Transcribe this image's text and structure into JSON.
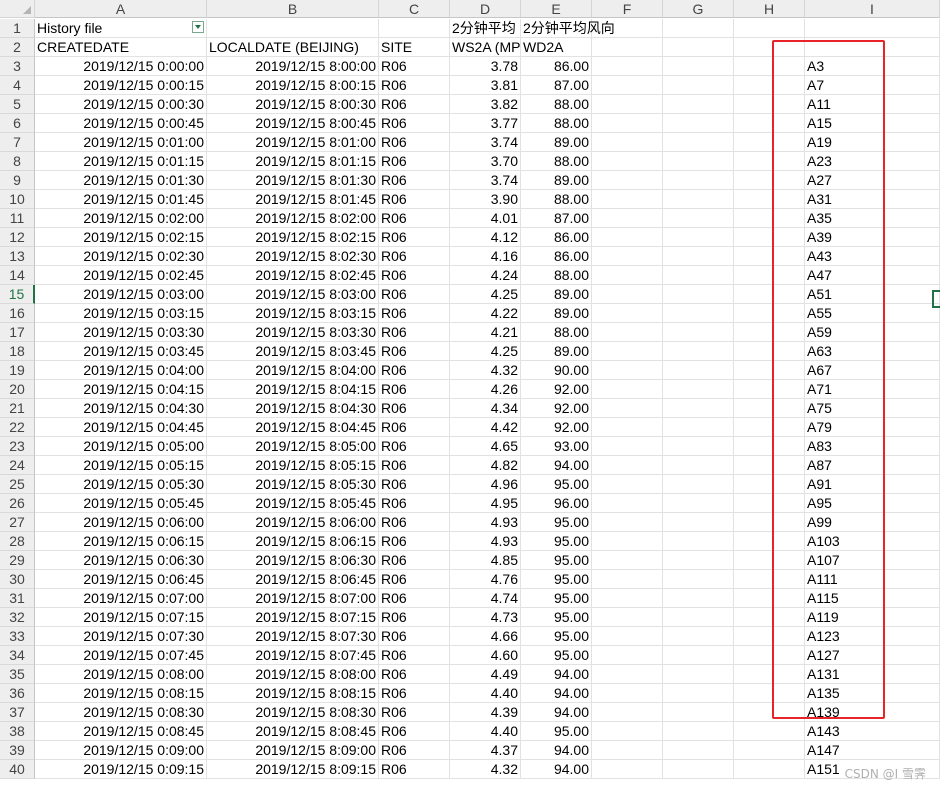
{
  "columns": [
    "A",
    "B",
    "C",
    "D",
    "E",
    "F",
    "G",
    "H",
    "I"
  ],
  "header_rows": [
    {
      "row": "1",
      "cells": {
        "A": "History file",
        "D": "2分钟平均",
        "E": "2分钟平均风向"
      }
    },
    {
      "row": "2",
      "cells": {
        "A": "CREATEDATE",
        "B": "LOCALDATE (BEIJING)",
        "C": "SITE",
        "D": "WS2A (MP",
        "E": "WD2A"
      }
    }
  ],
  "data_rows": [
    {
      "row": "3",
      "A": "2019/12/15 0:00:00",
      "B": "2019/12/15 8:00:00",
      "C": "R06",
      "D": "3.78",
      "E": "86.00",
      "I": "A3"
    },
    {
      "row": "4",
      "A": "2019/12/15 0:00:15",
      "B": "2019/12/15 8:00:15",
      "C": "R06",
      "D": "3.81",
      "E": "87.00",
      "I": "A7"
    },
    {
      "row": "5",
      "A": "2019/12/15 0:00:30",
      "B": "2019/12/15 8:00:30",
      "C": "R06",
      "D": "3.82",
      "E": "88.00",
      "I": "A11"
    },
    {
      "row": "6",
      "A": "2019/12/15 0:00:45",
      "B": "2019/12/15 8:00:45",
      "C": "R06",
      "D": "3.77",
      "E": "88.00",
      "I": "A15"
    },
    {
      "row": "7",
      "A": "2019/12/15 0:01:00",
      "B": "2019/12/15 8:01:00",
      "C": "R06",
      "D": "3.74",
      "E": "89.00",
      "I": "A19"
    },
    {
      "row": "8",
      "A": "2019/12/15 0:01:15",
      "B": "2019/12/15 8:01:15",
      "C": "R06",
      "D": "3.70",
      "E": "88.00",
      "I": "A23"
    },
    {
      "row": "9",
      "A": "2019/12/15 0:01:30",
      "B": "2019/12/15 8:01:30",
      "C": "R06",
      "D": "3.74",
      "E": "89.00",
      "I": "A27"
    },
    {
      "row": "10",
      "A": "2019/12/15 0:01:45",
      "B": "2019/12/15 8:01:45",
      "C": "R06",
      "D": "3.90",
      "E": "88.00",
      "I": "A31"
    },
    {
      "row": "11",
      "A": "2019/12/15 0:02:00",
      "B": "2019/12/15 8:02:00",
      "C": "R06",
      "D": "4.01",
      "E": "87.00",
      "I": "A35"
    },
    {
      "row": "12",
      "A": "2019/12/15 0:02:15",
      "B": "2019/12/15 8:02:15",
      "C": "R06",
      "D": "4.12",
      "E": "86.00",
      "I": "A39"
    },
    {
      "row": "13",
      "A": "2019/12/15 0:02:30",
      "B": "2019/12/15 8:02:30",
      "C": "R06",
      "D": "4.16",
      "E": "86.00",
      "I": "A43"
    },
    {
      "row": "14",
      "A": "2019/12/15 0:02:45",
      "B": "2019/12/15 8:02:45",
      "C": "R06",
      "D": "4.24",
      "E": "88.00",
      "I": "A47"
    },
    {
      "row": "15",
      "A": "2019/12/15 0:03:00",
      "B": "2019/12/15 8:03:00",
      "C": "R06",
      "D": "4.25",
      "E": "89.00",
      "I": "A51"
    },
    {
      "row": "16",
      "A": "2019/12/15 0:03:15",
      "B": "2019/12/15 8:03:15",
      "C": "R06",
      "D": "4.22",
      "E": "89.00",
      "I": "A55"
    },
    {
      "row": "17",
      "A": "2019/12/15 0:03:30",
      "B": "2019/12/15 8:03:30",
      "C": "R06",
      "D": "4.21",
      "E": "88.00",
      "I": "A59"
    },
    {
      "row": "18",
      "A": "2019/12/15 0:03:45",
      "B": "2019/12/15 8:03:45",
      "C": "R06",
      "D": "4.25",
      "E": "89.00",
      "I": "A63"
    },
    {
      "row": "19",
      "A": "2019/12/15 0:04:00",
      "B": "2019/12/15 8:04:00",
      "C": "R06",
      "D": "4.32",
      "E": "90.00",
      "I": "A67"
    },
    {
      "row": "20",
      "A": "2019/12/15 0:04:15",
      "B": "2019/12/15 8:04:15",
      "C": "R06",
      "D": "4.26",
      "E": "92.00",
      "I": "A71"
    },
    {
      "row": "21",
      "A": "2019/12/15 0:04:30",
      "B": "2019/12/15 8:04:30",
      "C": "R06",
      "D": "4.34",
      "E": "92.00",
      "I": "A75"
    },
    {
      "row": "22",
      "A": "2019/12/15 0:04:45",
      "B": "2019/12/15 8:04:45",
      "C": "R06",
      "D": "4.42",
      "E": "92.00",
      "I": "A79"
    },
    {
      "row": "23",
      "A": "2019/12/15 0:05:00",
      "B": "2019/12/15 8:05:00",
      "C": "R06",
      "D": "4.65",
      "E": "93.00",
      "I": "A83"
    },
    {
      "row": "24",
      "A": "2019/12/15 0:05:15",
      "B": "2019/12/15 8:05:15",
      "C": "R06",
      "D": "4.82",
      "E": "94.00",
      "I": "A87"
    },
    {
      "row": "25",
      "A": "2019/12/15 0:05:30",
      "B": "2019/12/15 8:05:30",
      "C": "R06",
      "D": "4.96",
      "E": "95.00",
      "I": "A91"
    },
    {
      "row": "26",
      "A": "2019/12/15 0:05:45",
      "B": "2019/12/15 8:05:45",
      "C": "R06",
      "D": "4.95",
      "E": "96.00",
      "I": "A95"
    },
    {
      "row": "27",
      "A": "2019/12/15 0:06:00",
      "B": "2019/12/15 8:06:00",
      "C": "R06",
      "D": "4.93",
      "E": "95.00",
      "I": "A99"
    },
    {
      "row": "28",
      "A": "2019/12/15 0:06:15",
      "B": "2019/12/15 8:06:15",
      "C": "R06",
      "D": "4.93",
      "E": "95.00",
      "I": "A103"
    },
    {
      "row": "29",
      "A": "2019/12/15 0:06:30",
      "B": "2019/12/15 8:06:30",
      "C": "R06",
      "D": "4.85",
      "E": "95.00",
      "I": "A107"
    },
    {
      "row": "30",
      "A": "2019/12/15 0:06:45",
      "B": "2019/12/15 8:06:45",
      "C": "R06",
      "D": "4.76",
      "E": "95.00",
      "I": "A111"
    },
    {
      "row": "31",
      "A": "2019/12/15 0:07:00",
      "B": "2019/12/15 8:07:00",
      "C": "R06",
      "D": "4.74",
      "E": "95.00",
      "I": "A115"
    },
    {
      "row": "32",
      "A": "2019/12/15 0:07:15",
      "B": "2019/12/15 8:07:15",
      "C": "R06",
      "D": "4.73",
      "E": "95.00",
      "I": "A119"
    },
    {
      "row": "33",
      "A": "2019/12/15 0:07:30",
      "B": "2019/12/15 8:07:30",
      "C": "R06",
      "D": "4.66",
      "E": "95.00",
      "I": "A123"
    },
    {
      "row": "34",
      "A": "2019/12/15 0:07:45",
      "B": "2019/12/15 8:07:45",
      "C": "R06",
      "D": "4.60",
      "E": "95.00",
      "I": "A127"
    },
    {
      "row": "35",
      "A": "2019/12/15 0:08:00",
      "B": "2019/12/15 8:08:00",
      "C": "R06",
      "D": "4.49",
      "E": "94.00",
      "I": "A131"
    },
    {
      "row": "36",
      "A": "2019/12/15 0:08:15",
      "B": "2019/12/15 8:08:15",
      "C": "R06",
      "D": "4.40",
      "E": "94.00",
      "I": "A135"
    },
    {
      "row": "37",
      "A": "2019/12/15 0:08:30",
      "B": "2019/12/15 8:08:30",
      "C": "R06",
      "D": "4.39",
      "E": "94.00",
      "I": "A139"
    },
    {
      "row": "38",
      "A": "2019/12/15 0:08:45",
      "B": "2019/12/15 8:08:45",
      "C": "R06",
      "D": "4.40",
      "E": "95.00",
      "I": "A143"
    },
    {
      "row": "39",
      "A": "2019/12/15 0:09:00",
      "B": "2019/12/15 8:09:00",
      "C": "R06",
      "D": "4.37",
      "E": "94.00",
      "I": "A147"
    },
    {
      "row": "40",
      "A": "2019/12/15 0:09:15",
      "B": "2019/12/15 8:09:15",
      "C": "R06",
      "D": "4.32",
      "E": "94.00",
      "I": "A151"
    }
  ],
  "active_row": "15",
  "highlight_color": "#e8232a",
  "accent_color": "#217346",
  "icons": {
    "filter": "filter-dropdown-icon",
    "select_all": "select-all-corner-icon"
  },
  "watermark": "CSDN @I 雪霁"
}
